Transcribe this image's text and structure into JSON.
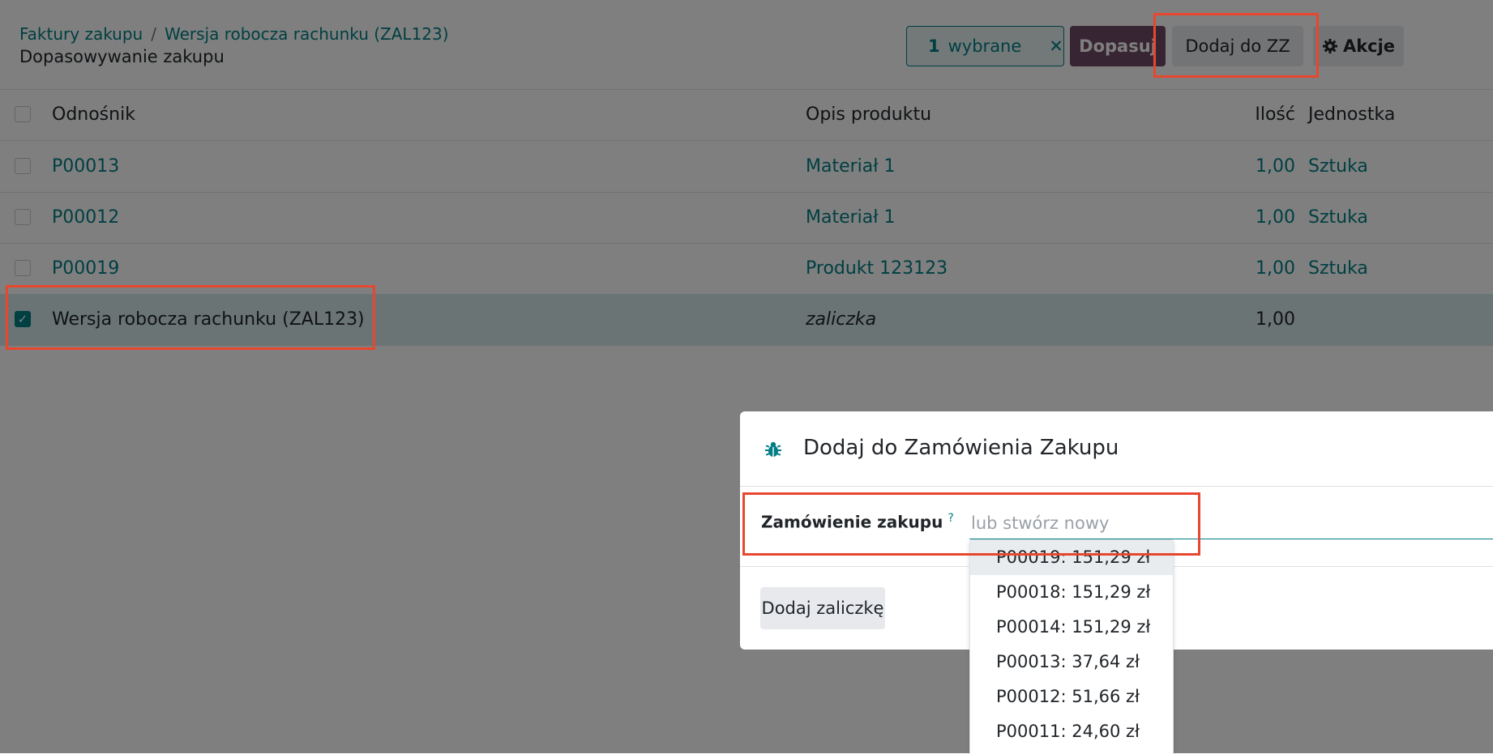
{
  "breadcrumb": {
    "root": "Faktury zakupu",
    "separator": "/",
    "current": "Wersja robocza rachunku (ZAL123)"
  },
  "page_title": "Dopasowywanie zakupu",
  "toolbar": {
    "selected_count": "1",
    "selected_label": "wybrane",
    "clear_icon": "✕",
    "match_label": "Dopasuj",
    "add_to_po_label": "Dodaj do ZZ",
    "actions_label": "Akcje"
  },
  "table": {
    "columns": [
      "Odnośnik",
      "Opis produktu",
      "Ilość",
      "Jednostka"
    ],
    "rows": [
      {
        "ref": "P00013",
        "desc": "Materiał 1",
        "qty": "1,00",
        "unit": "Sztuka",
        "checked": false
      },
      {
        "ref": "P00012",
        "desc": "Materiał 1",
        "qty": "1,00",
        "unit": "Sztuka",
        "checked": false
      },
      {
        "ref": "P00019",
        "desc": "Produkt 123123",
        "qty": "1,00",
        "unit": "Sztuka",
        "checked": false
      },
      {
        "ref": "Wersja robocza rachunku (ZAL123)",
        "desc": "zaliczka",
        "qty": "1,00",
        "unit": "",
        "checked": true
      }
    ]
  },
  "modal": {
    "title": "Dodaj do Zamówienia Zakupu",
    "field_label": "Zamówienie zakupu",
    "help_mark": "?",
    "input_placeholder": "lub stwórz nowy",
    "advance_button": "Dodaj zaliczkę"
  },
  "dropdown": {
    "items": [
      "P00019: 151,29 zł",
      "P00018: 151,29 zł",
      "P00014: 151,29 zł",
      "P00013: 37,64 zł",
      "P00012: 51,66 zł",
      "P00011: 24,60 zł"
    ]
  },
  "colors": {
    "accent": "#017e84",
    "primary": "#714b67",
    "annotation": "#e8472f"
  },
  "icons": [
    "bug-icon",
    "gear-icon",
    "close-icon",
    "checkbox-icon"
  ]
}
